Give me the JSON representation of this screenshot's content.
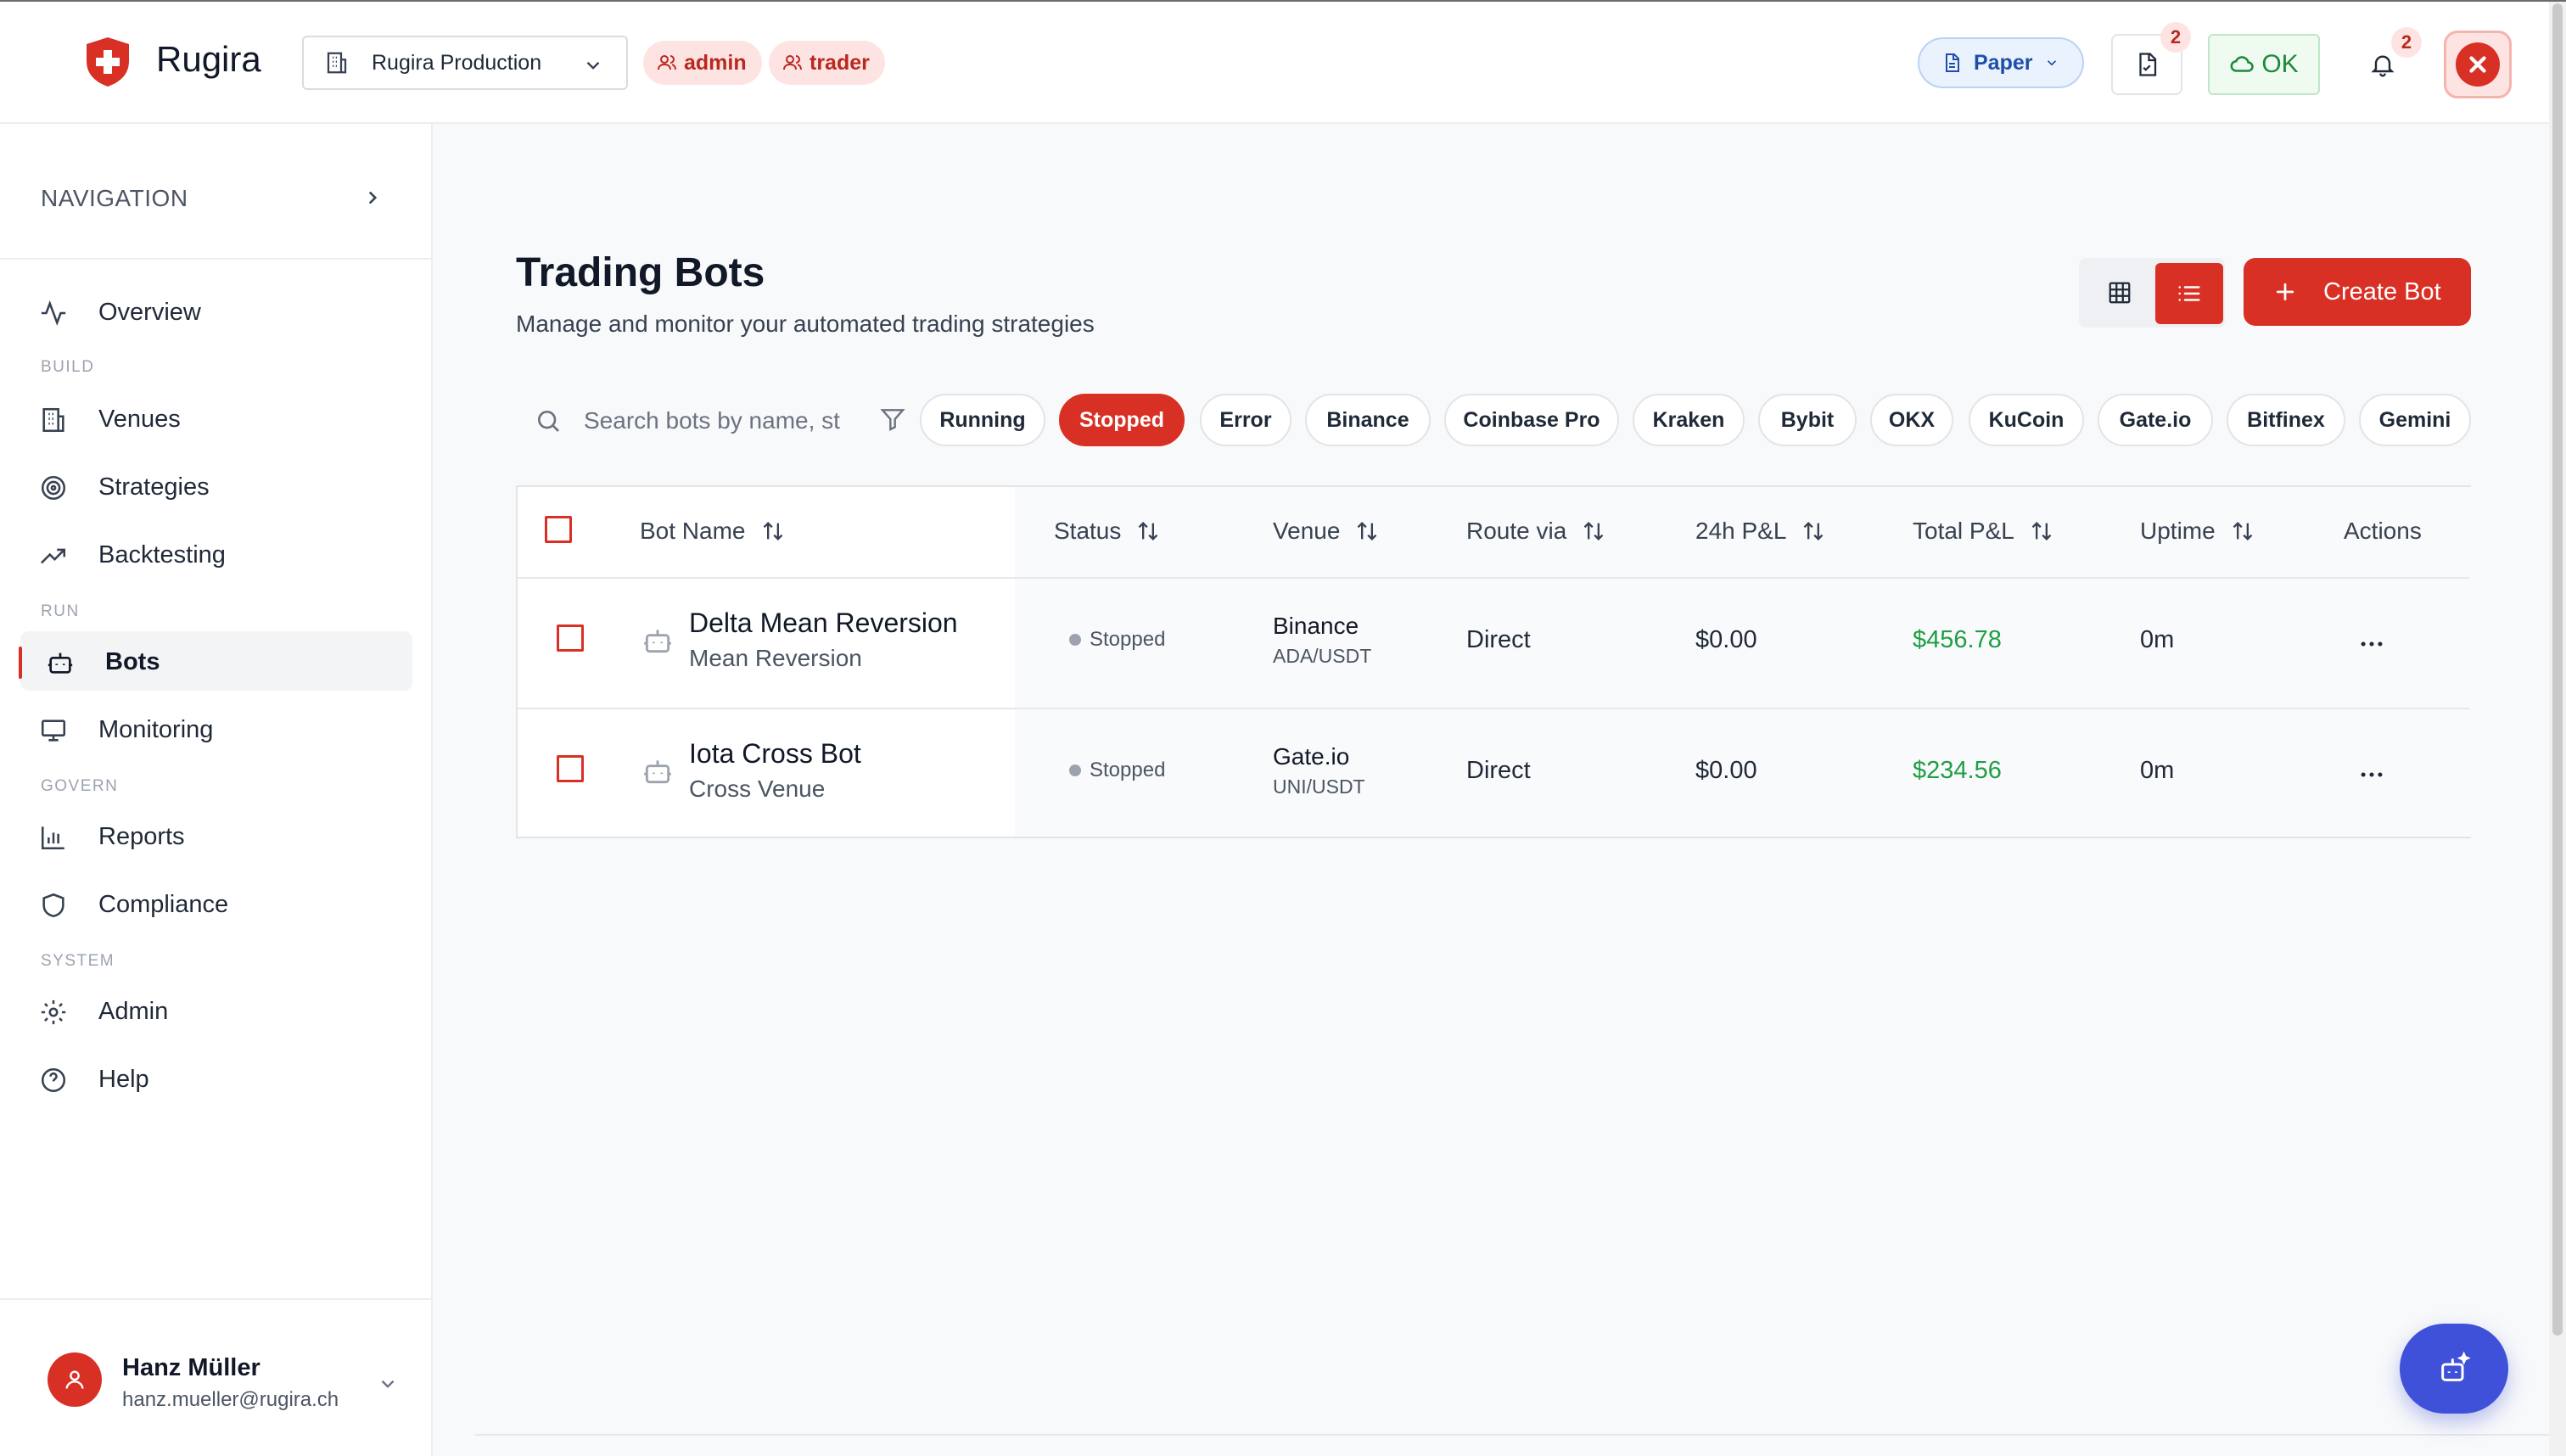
{
  "header": {
    "brand": "Rugira",
    "org_select": "Rugira Production",
    "roles": [
      "admin",
      "trader"
    ],
    "mode": "Paper",
    "docs_badge": "2",
    "health": "OK",
    "notifications_badge": "2",
    "colors": {
      "accent": "#d93025",
      "info": "#1e4fa8",
      "success": "#1b8a3a"
    }
  },
  "sidebar": {
    "title": "NAVIGATION",
    "sections": {
      "build": "BUILD",
      "run": "RUN",
      "govern": "GOVERN",
      "system": "SYSTEM"
    },
    "items": [
      {
        "label": "Overview",
        "icon": "activity-icon"
      },
      {
        "label": "Venues",
        "icon": "building-icon"
      },
      {
        "label": "Strategies",
        "icon": "target-icon"
      },
      {
        "label": "Backtesting",
        "icon": "trending-up-icon"
      },
      {
        "label": "Bots",
        "icon": "bot-icon",
        "active": true
      },
      {
        "label": "Monitoring",
        "icon": "monitor-icon"
      },
      {
        "label": "Reports",
        "icon": "bar-chart-icon"
      },
      {
        "label": "Compliance",
        "icon": "shield-icon"
      },
      {
        "label": "Admin",
        "icon": "gear-icon"
      },
      {
        "label": "Help",
        "icon": "help-circle-icon"
      }
    ],
    "user": {
      "name": "Hanz Müller",
      "email": "hanz.mueller@rugira.ch"
    }
  },
  "main": {
    "title": "Trading Bots",
    "subtitle": "Manage and monitor your automated trading strategies",
    "create_label": "Create Bot",
    "search_placeholder": "Search bots by name, st",
    "filters": [
      {
        "label": "Running",
        "active": false
      },
      {
        "label": "Stopped",
        "active": true
      },
      {
        "label": "Error",
        "active": false
      },
      {
        "label": "Binance",
        "active": false
      },
      {
        "label": "Coinbase Pro",
        "active": false
      },
      {
        "label": "Kraken",
        "active": false
      },
      {
        "label": "Bybit",
        "active": false
      },
      {
        "label": "OKX",
        "active": false
      },
      {
        "label": "KuCoin",
        "active": false
      },
      {
        "label": "Gate.io",
        "active": false
      },
      {
        "label": "Bitfinex",
        "active": false
      },
      {
        "label": "Gemini",
        "active": false
      }
    ],
    "table": {
      "columns": [
        "Bot Name",
        "Status",
        "Venue",
        "Route via",
        "24h P&L",
        "Total P&L",
        "Uptime",
        "Actions"
      ],
      "rows": [
        {
          "name": "Delta Mean Reversion",
          "strategy": "Mean Reversion",
          "status": "Stopped",
          "venue": "Binance",
          "pair": "ADA/USDT",
          "route": "Direct",
          "pnl_24h": "$0.00",
          "pnl_total": "$456.78",
          "uptime": "0m"
        },
        {
          "name": "Iota Cross Bot",
          "strategy": "Cross Venue",
          "status": "Stopped",
          "venue": "Gate.io",
          "pair": "UNI/USDT",
          "route": "Direct",
          "pnl_24h": "$0.00",
          "pnl_total": "$234.56",
          "uptime": "0m"
        }
      ]
    }
  }
}
